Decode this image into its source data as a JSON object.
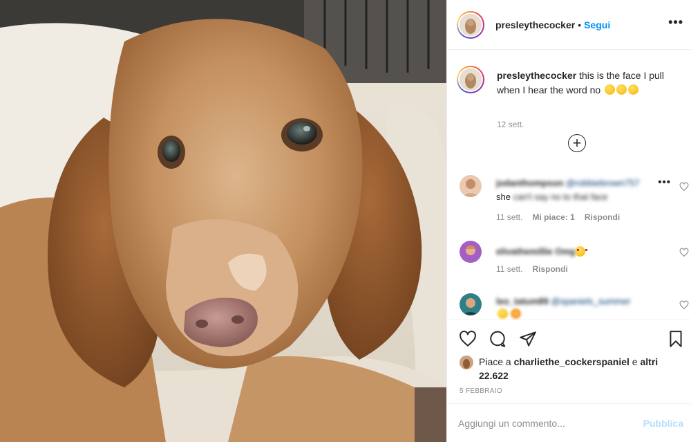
{
  "post": {
    "username": "presleythecocker",
    "separator": "•",
    "follow_label": "Segui",
    "more_label": "•••"
  },
  "caption": {
    "username": "presleythecocker",
    "text": "this is the face I pull when I hear the word no",
    "emojis": [
      "pleading-face-emoji",
      "pleading-face-emoji",
      "pleading-face-emoji"
    ],
    "time": "12 sett."
  },
  "load_more_label": "+",
  "comments": [
    {
      "username": "jodanthompson",
      "mention": "@robbiebrown757",
      "text_visible": "she",
      "text_blurred": "can't say no to that face",
      "time": "11 sett.",
      "likes": "Mi piace: 1",
      "reply": "Rispondi",
      "more": "•••"
    },
    {
      "username": "elivathemillie Omg",
      "emoji": "heart-eyes-emoji",
      "time": "11 sett.",
      "reply": "Rispondi"
    },
    {
      "username": "leo_tatum89",
      "mention": "@spaniels_summer"
    }
  ],
  "likes": {
    "prefix": "Piace a ",
    "user": "charliethe_cockerspaniel",
    "middle": " e ",
    "others": "altri 22.622"
  },
  "date": "5 FEBBRAIO",
  "add_comment": {
    "placeholder": "Aggiungi un commento...",
    "publish_label": "Pubblica"
  },
  "colors": {
    "link_blue": "#0095f6",
    "publish_disabled": "#b2dffc",
    "secondary_text": "#8e8e8e",
    "primary_text": "#262626"
  },
  "icons": [
    "heart-icon",
    "comment-icon",
    "share-icon",
    "bookmark-icon"
  ]
}
